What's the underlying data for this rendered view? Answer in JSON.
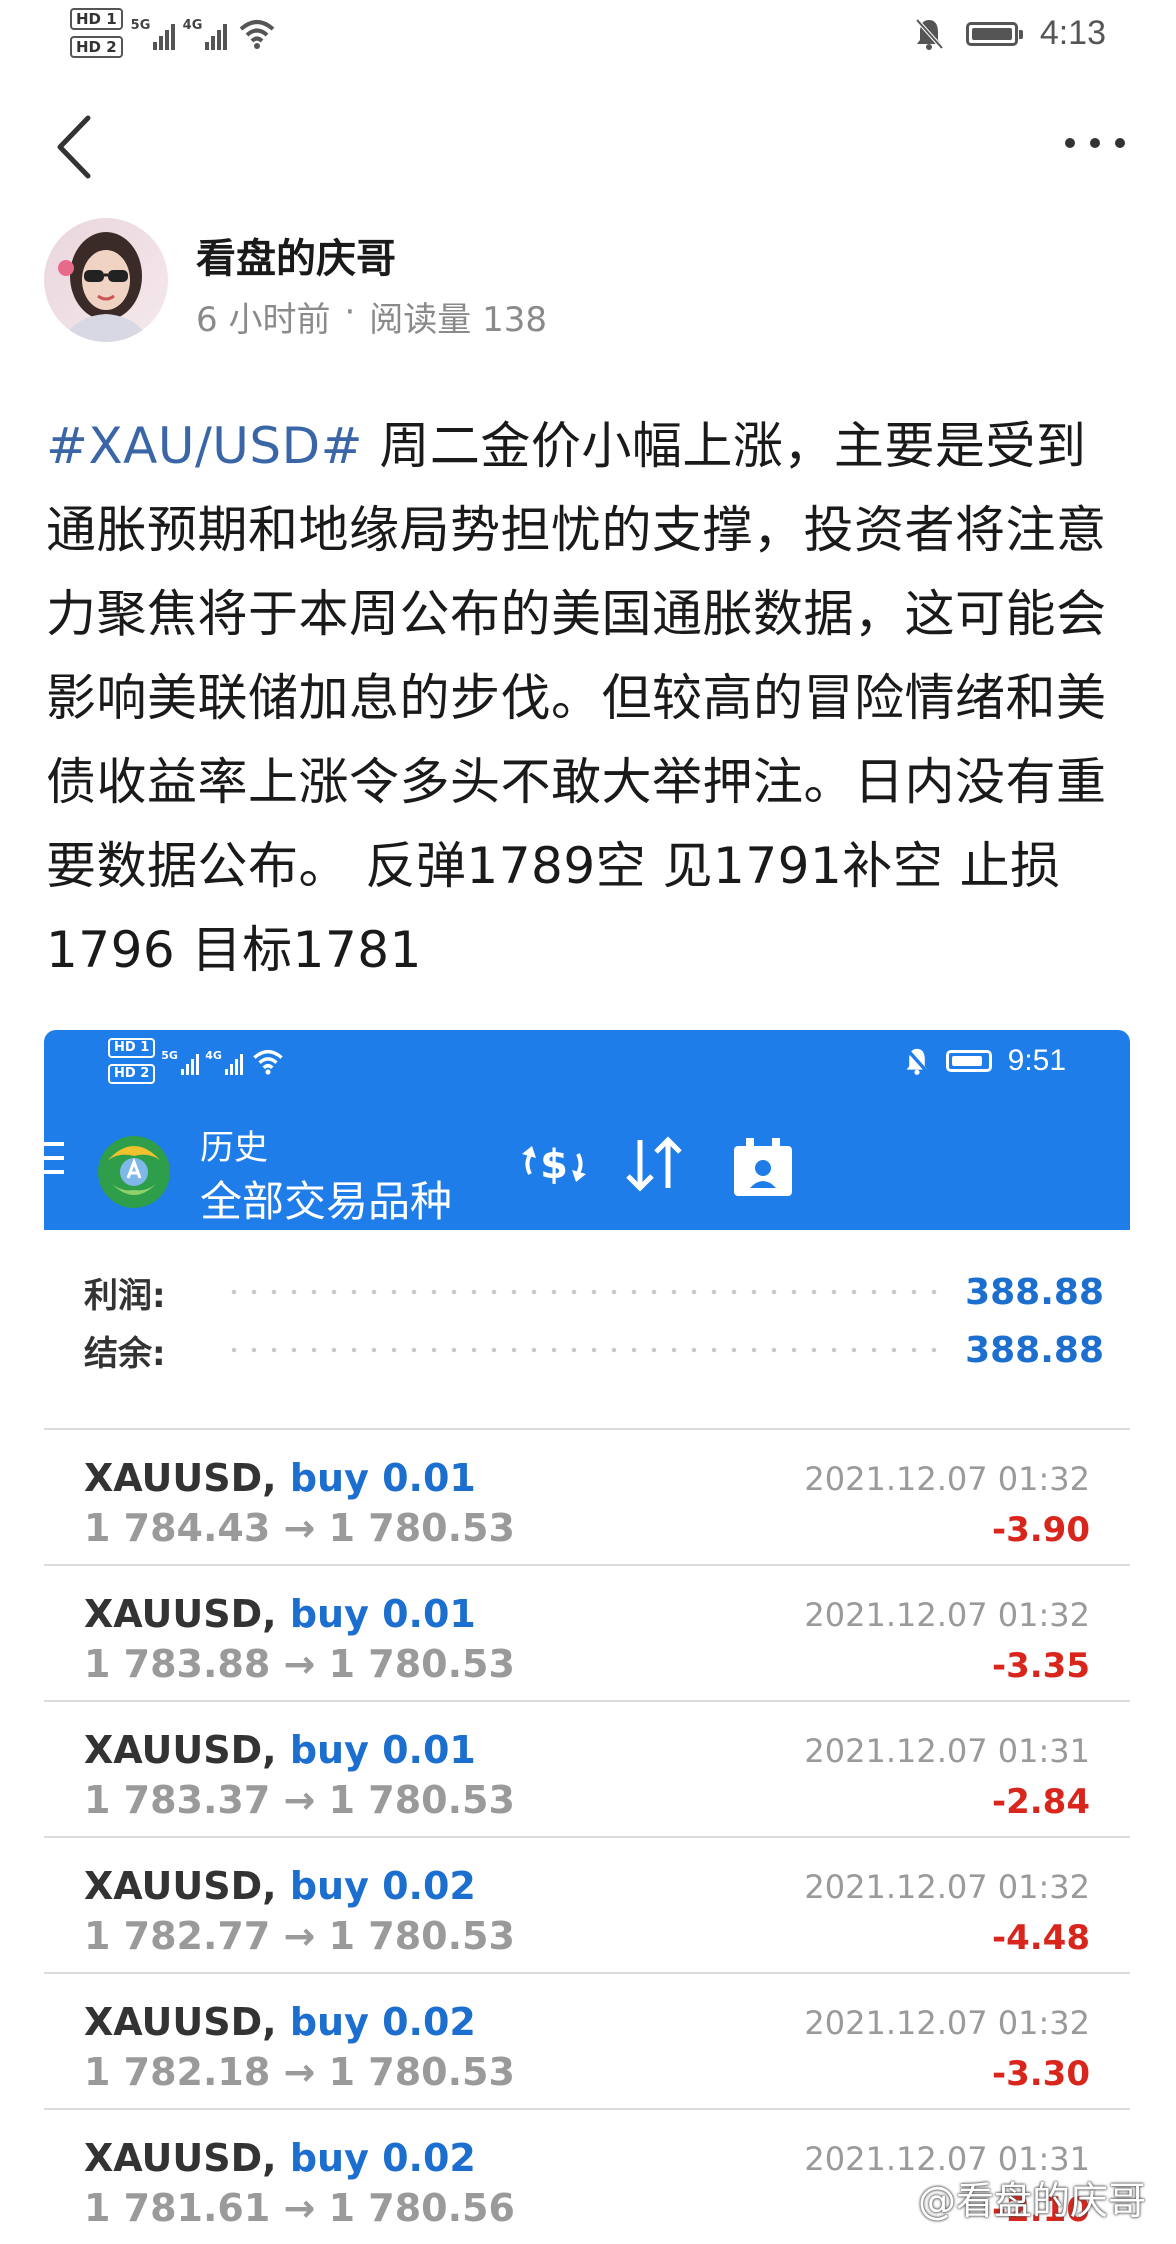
{
  "status_bar": {
    "sim1": "HD 1",
    "sim2": "HD 2",
    "net1": "5G",
    "net2": "4G",
    "time": "4:13",
    "icons": [
      "signal-icon",
      "wifi-icon",
      "mute-bell-icon",
      "battery-icon"
    ]
  },
  "nav": {
    "back_icon": "back-chevron-icon",
    "more_icon": "more-dots-icon"
  },
  "author": {
    "name": "看盘的庆哥",
    "time_ago": "6 小时前",
    "separator": "·",
    "reads": "阅读量 138"
  },
  "post": {
    "hashtag": "#XAU/USD#",
    "text": " 周二金价小幅上涨，主要是受到通胀预期和地缘局势担忧的支撑，投资者将注意力聚焦将于本周公布的美国通胀数据，这可能会影响美联储加息的步伐。但较高的冒险情绪和美债收益率上涨令多头不敢大举押注。日内没有重要数据公布。 反弹1789空 见1791补空 止损1796 目标1781"
  },
  "embedded": {
    "status": {
      "sim1": "HD 1",
      "sim2": "HD 2",
      "net1": "5G",
      "net2": "4G",
      "time": "9:51"
    },
    "header": {
      "subtitle": "历史",
      "title": "全部交易品种",
      "icons": [
        "menu-icon",
        "metatrader-logo",
        "currency-exchange-icon",
        "sort-icon",
        "calendar-icon"
      ],
      "accent": "#1e7de8"
    },
    "summary": {
      "profit_label": "利润:",
      "profit_value": "388.88",
      "balance_label": "结余:",
      "balance_value": "388.88"
    },
    "trades": [
      {
        "symbol": "XAUUSD,",
        "side": "buy 0.01",
        "prices": "1 784.43 → 1 780.53",
        "datetime": "2021.12.07 01:32",
        "profit": "-3.90"
      },
      {
        "symbol": "XAUUSD,",
        "side": "buy 0.01",
        "prices": "1 783.88 → 1 780.53",
        "datetime": "2021.12.07 01:32",
        "profit": "-3.35"
      },
      {
        "symbol": "XAUUSD,",
        "side": "buy 0.01",
        "prices": "1 783.37 → 1 780.53",
        "datetime": "2021.12.07 01:31",
        "profit": "-2.84"
      },
      {
        "symbol": "XAUUSD,",
        "side": "buy 0.02",
        "prices": "1 782.77 → 1 780.53",
        "datetime": "2021.12.07 01:32",
        "profit": "-4.48"
      },
      {
        "symbol": "XAUUSD,",
        "side": "buy 0.02",
        "prices": "1 782.18 → 1 780.53",
        "datetime": "2021.12.07 01:32",
        "profit": "-3.30"
      },
      {
        "symbol": "XAUUSD,",
        "side": "buy 0.02",
        "prices": "1 781.61 → 1 780.56",
        "datetime": "2021.12.07 01:31",
        "profit": "-2.10"
      }
    ]
  },
  "watermark": "@看盘的庆哥",
  "colors": {
    "link_blue": "#3a66a8",
    "value_blue": "#1c6fcf",
    "loss_red": "#d9261c"
  }
}
